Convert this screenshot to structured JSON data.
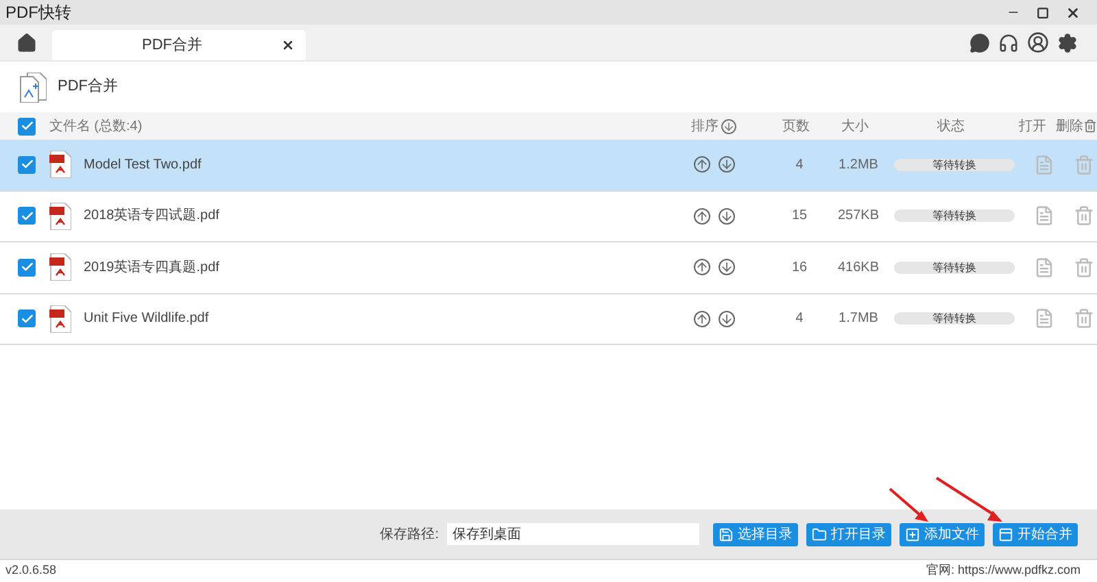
{
  "window": {
    "title": "PDF快转"
  },
  "tabs": [
    {
      "label": "PDF合并",
      "selected": true
    }
  ],
  "tool": {
    "title": "PDF合并"
  },
  "table": {
    "all_checked": true,
    "columns": [
      "文件名 (总数:4)",
      "排序",
      "页数",
      "大小",
      "状态",
      "打开",
      "删除"
    ],
    "rows": [
      {
        "name": "Model Test Two.pdf",
        "pages": "4",
        "size": "1.2MB",
        "status": "等待转换",
        "checked": true,
        "selected": true
      },
      {
        "name": "2018英语专四试题.pdf",
        "pages": "15",
        "size": "257KB",
        "status": "等待转换",
        "checked": true,
        "selected": false
      },
      {
        "name": "2019英语专四真题.pdf",
        "pages": "16",
        "size": "416KB",
        "status": "等待转换",
        "checked": true,
        "selected": false
      },
      {
        "name": "Unit Five Wildlife.pdf",
        "pages": "4",
        "size": "1.7MB",
        "status": "等待转换",
        "checked": true,
        "selected": false
      }
    ]
  },
  "save": {
    "label": "保存路径:",
    "value": "保存到桌面"
  },
  "buttons": [
    {
      "kind": "save",
      "label": "选择目录"
    },
    {
      "kind": "folder",
      "label": "打开目录"
    },
    {
      "kind": "add",
      "label": "添加文件"
    },
    {
      "kind": "merge",
      "label": "开始合并"
    }
  ],
  "status_bar": {
    "version": "v2.0.6.58",
    "website": "官网: https://www.pdfkz.com"
  }
}
